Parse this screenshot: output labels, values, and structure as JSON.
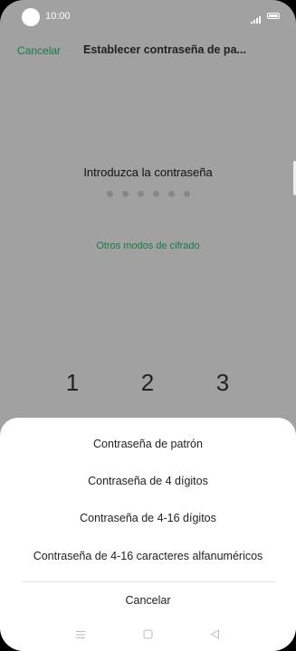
{
  "status_bar": {
    "time": "10:00"
  },
  "header": {
    "cancel_label": "Cancelar",
    "title": "Establecer contraseña de pa..."
  },
  "prompt": {
    "text": "Introduzca la contraseña",
    "dot_count": 6
  },
  "other_modes_label": "Otros modos de cifrado",
  "keypad": {
    "keys": [
      "1",
      "2",
      "3"
    ]
  },
  "sheet": {
    "options": [
      "Contraseña de patrón",
      "Contraseña de 4 dígitos",
      "Contraseña de 4-16 dígitos",
      "Contraseña de 4-16 caracteres alfanuméricos"
    ],
    "cancel_label": "Cancelar"
  },
  "nav_icons": [
    "menu-icon",
    "home-icon",
    "back-icon"
  ],
  "colors": {
    "accent": "#1a7a45",
    "overlay": "#a1a1a1",
    "sheet": "#ffffff"
  }
}
